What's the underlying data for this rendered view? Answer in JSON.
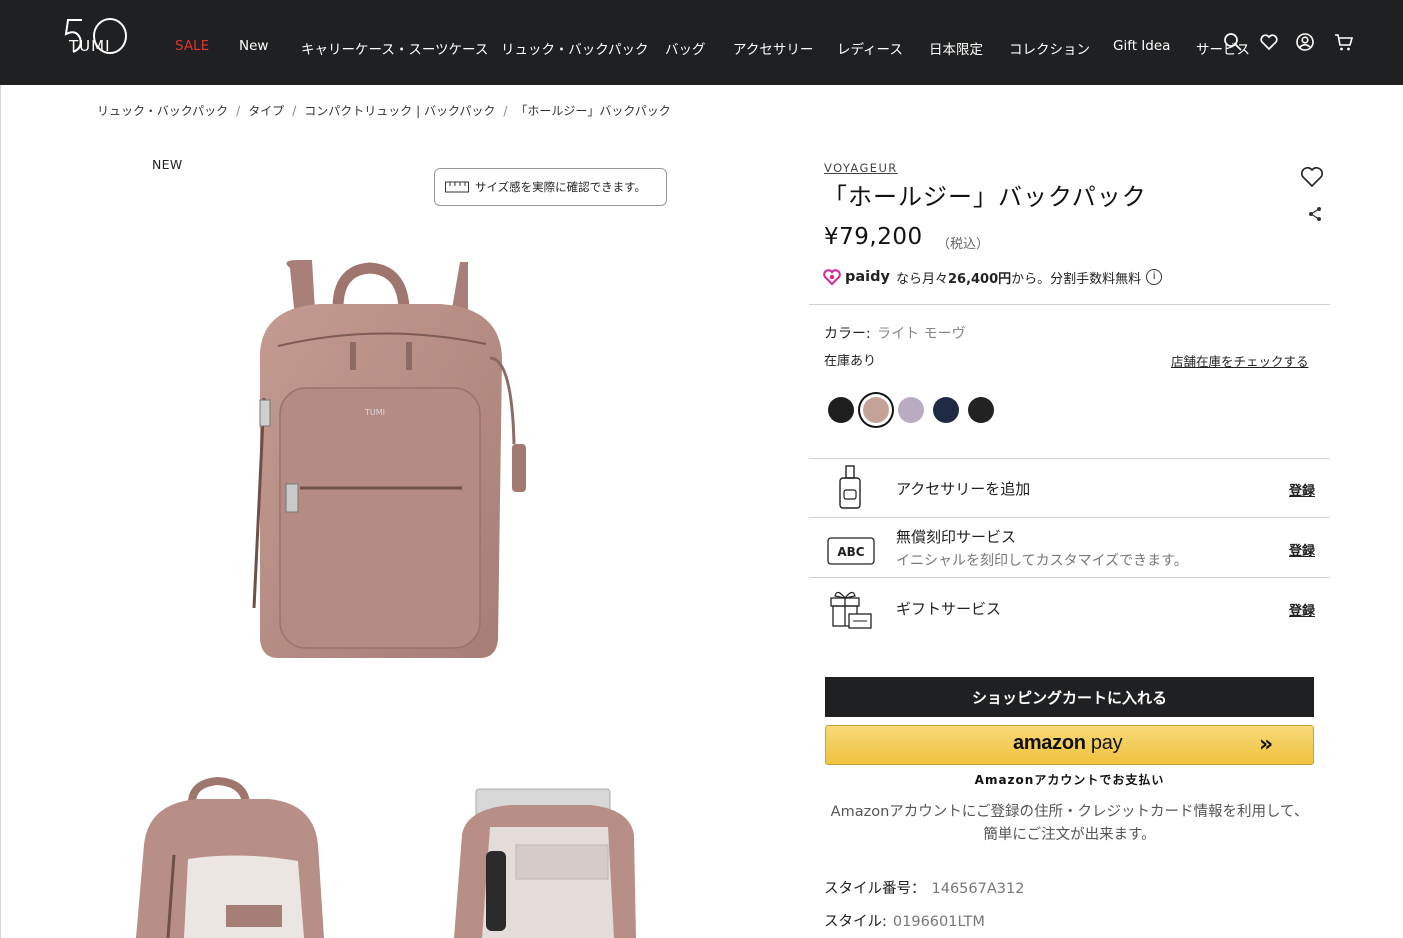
{
  "header": {
    "logo_label": "TUMI",
    "nav": [
      {
        "label": "SALE",
        "sale": true
      },
      {
        "label": "New"
      },
      {
        "label": "キャリーケース・スーツケース"
      },
      {
        "label": "リュック・バックパック"
      },
      {
        "label": "バッグ"
      },
      {
        "label": "アクセサリー"
      },
      {
        "label": "レディース"
      },
      {
        "label": "日本限定"
      },
      {
        "label": "コレクション"
      },
      {
        "label": "Gift Idea"
      },
      {
        "label": "サービス"
      }
    ],
    "icons": [
      "search-icon",
      "heart-icon",
      "account-icon",
      "cart-icon"
    ]
  },
  "breadcrumb": [
    "リュック・バックパック",
    "タイプ",
    "コンパクトリュック | バックパック",
    "「ホールジー」バックパック"
  ],
  "gallery": {
    "badge": "NEW",
    "size_check_label": "サイズ感を実際に確認できます。"
  },
  "product": {
    "brand": "VOYAGEUR",
    "title": "「ホールジー」バックパック",
    "price": "¥79,200",
    "tax_note": "（税込）",
    "paidy": {
      "logo_text": "paidy",
      "text": "なら月々",
      "amount": "26,400円",
      "text2": "から。分割手数料無料"
    },
    "color_label": "カラー:",
    "color_value": "ライト モーヴ",
    "stock_status": "在庫あり",
    "store_check_label": "店舗在庫をチェックする",
    "swatches": [
      {
        "name": "black",
        "color": "#1e1e1e",
        "selected": false
      },
      {
        "name": "light-mauve",
        "color": "#c4a298",
        "selected": true
      },
      {
        "name": "lilac",
        "color": "#b9abc0",
        "selected": false
      },
      {
        "name": "navy",
        "color": "#1f2a44",
        "selected": false
      },
      {
        "name": "black-2",
        "color": "#222222",
        "selected": false
      }
    ],
    "services": [
      {
        "title": "アクセサリーを追加",
        "subtitle": "",
        "action": "登録"
      },
      {
        "title": "無償刻印サービス",
        "subtitle": "イニシャルを刻印してカスタマイズできます。",
        "action": "登録",
        "icon_text": "ABC"
      },
      {
        "title": "ギフトサービス",
        "subtitle": "",
        "action": "登録"
      }
    ],
    "add_to_cart_label": "ショッピングカートに入れる",
    "amazon_pay": {
      "brand_a": "amazon",
      "brand_b": " pay",
      "note": "Amazonアカウントでお支払い",
      "description": "Amazonアカウントにご登録の住所・クレジットカード情報を利用して、簡単にご注文が出来ます。"
    },
    "specs": [
      {
        "label": "スタイル番号：",
        "value": "146567A312"
      },
      {
        "label": "スタイル:",
        "value": "0196601LTM"
      }
    ]
  },
  "colors": {
    "header_bg": "#1f2021",
    "sale_red": "#e0352b",
    "product_mauve": "#b88f86"
  }
}
